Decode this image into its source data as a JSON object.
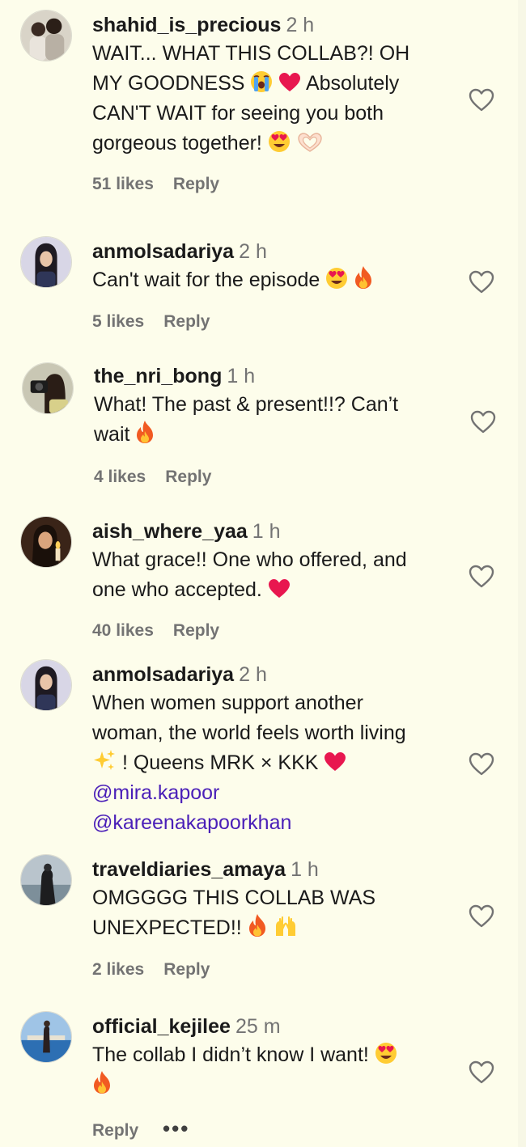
{
  "comments": [
    {
      "username": "shahid_is_precious",
      "time": "2 h",
      "lines": [
        "WAIT... WHAT THIS COLLAB?! OH",
        "MY GOODNESS",
        "Absolutely",
        "CAN'T WAIT for seeing you both",
        "gorgeous together!"
      ],
      "likes": "51 likes",
      "reply": "Reply",
      "avatar_icon": "avatar-couple-photo"
    },
    {
      "username": "anmolsadariya",
      "time": "2 h",
      "lines": [
        "Can't wait for the episode"
      ],
      "likes": "5 likes",
      "reply": "Reply",
      "avatar_icon": "avatar-girl-photo"
    },
    {
      "username": "the_nri_bong",
      "time": "1 h",
      "lines": [
        "What! The past & present!!? Can’t",
        "wait"
      ],
      "likes": "4 likes",
      "reply": "Reply",
      "avatar_icon": "avatar-camera-photo"
    },
    {
      "username": "aish_where_yaa",
      "time": "1 h",
      "lines": [
        "What grace!! One who offered, and",
        "one who accepted."
      ],
      "likes": "40 likes",
      "reply": "Reply",
      "avatar_icon": "avatar-candle-photo"
    },
    {
      "username": "anmolsadariya",
      "time": "2 h",
      "lines": [
        "When women support another",
        "woman, the world feels worth living",
        "! Queens MRK × KKK"
      ],
      "mentions": [
        "@mira.kapoor",
        "@kareenakapoorkhan"
      ],
      "avatar_icon": "avatar-girl-photo"
    },
    {
      "username": "traveldiaries_amaya",
      "time": "1 h",
      "lines": [
        "OMGGGG THIS COLLAB WAS",
        "UNEXPECTED!!"
      ],
      "likes": "2 likes",
      "reply": "Reply",
      "avatar_icon": "avatar-beach-photo"
    },
    {
      "username": "official_kejilee",
      "time": "25 m",
      "lines": [
        "The collab I didn’t know I want!"
      ],
      "reply": "Reply",
      "more": "•••",
      "avatar_icon": "avatar-pool-photo"
    }
  ],
  "icons": {
    "like": "heart-outline-icon",
    "emoji_crying": "loudly-crying-face",
    "emoji_heart": "red-heart",
    "emoji_heart_eyes": "smiling-face-with-heart-eyes",
    "emoji_heart_hands": "heart-hands",
    "emoji_fire": "fire",
    "emoji_sparkles": "sparkles",
    "emoji_raised_hands": "raising-hands"
  },
  "colors": {
    "background": "#fdfdeb",
    "text": "#1a1a1a",
    "muted": "#737373",
    "mention": "#4a1fb8"
  }
}
